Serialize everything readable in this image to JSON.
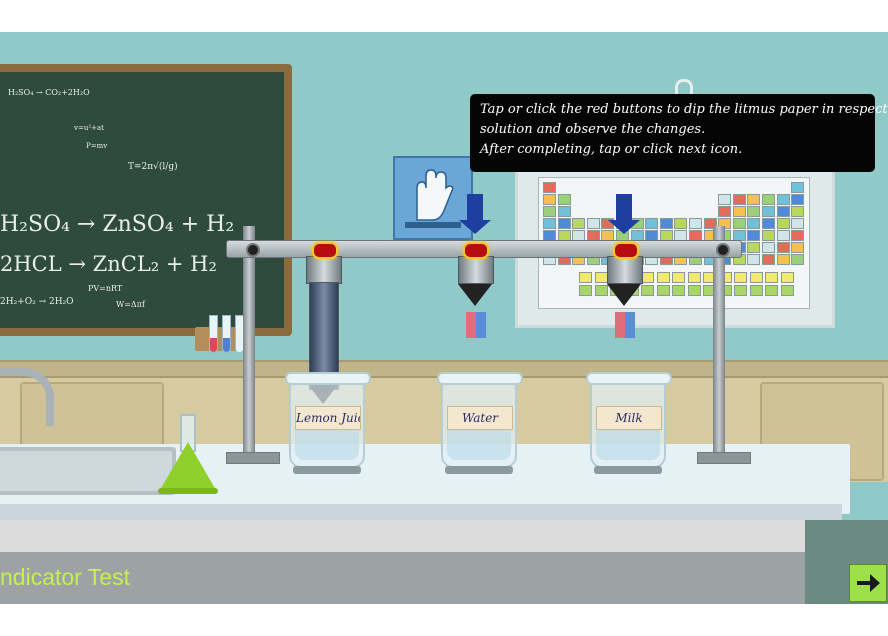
{
  "scene": {
    "chalkboard": {
      "eq_small_1": "H₂SO₄ → CO₂+2H₂O",
      "eq_small_2": "v=u²+at",
      "eq_small_3": "P=mv",
      "eq_small_4": "T=2π√(l/g)",
      "eq_1": "H₂SO₄ → ZnSO₄ + H₂",
      "eq_2": "2HCL → ZnCL₂ + H₂",
      "eq_3": "PV=nRT",
      "eq_4": "2H₂+O₂ → 2H₂O",
      "eq_5": "W=Δπf"
    },
    "beakers": [
      {
        "label": "Lemon Juice"
      },
      {
        "label": "Water"
      },
      {
        "label": "Milk"
      }
    ],
    "instruction": {
      "line1": "Tap or click the red buttons to dip the litmus paper in respective",
      "line2": "solution and observe the changes.",
      "line3": "After completing, tap or click next icon."
    },
    "colors": {
      "dip_button": "#b70d12",
      "dip_button_ring": "#f2c72a",
      "arrow": "#1d3f9f",
      "title_text": "#c7f04d",
      "next_button": "#9ee04a",
      "flask_liquid": "#8fd12a"
    }
  },
  "footer": {
    "title": "ndicator Test",
    "next_icon": "arrow-right-icon"
  }
}
